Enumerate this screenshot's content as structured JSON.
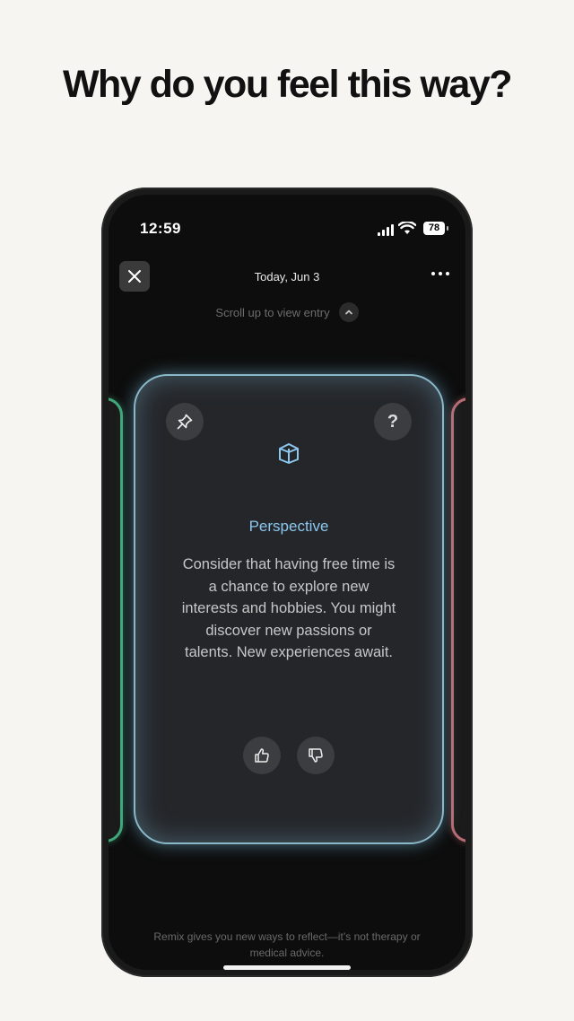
{
  "headline": "Why do you feel this way?",
  "status_bar": {
    "time": "12:59",
    "battery": "78"
  },
  "header": {
    "date": "Today, Jun 3",
    "scroll_hint": "Scroll up to view entry"
  },
  "card": {
    "title": "Perspective",
    "body": "Consider that having free time is a chance to explore new interests and hobbies. You might discover new passions or talents. New experiences await.",
    "help_label": "?",
    "accent_color": "#8cc7ee"
  },
  "side_cards": {
    "left_color": "#3fa77a",
    "right_color": "#b86b72"
  },
  "disclaimer": "Remix gives you new ways to reflect—it’s not therapy or medical advice.",
  "icons": [
    "close-icon",
    "more-icon",
    "chevron-up-icon",
    "pin-icon",
    "help-icon",
    "book-icon",
    "thumbs-up-icon",
    "thumbs-down-icon"
  ]
}
